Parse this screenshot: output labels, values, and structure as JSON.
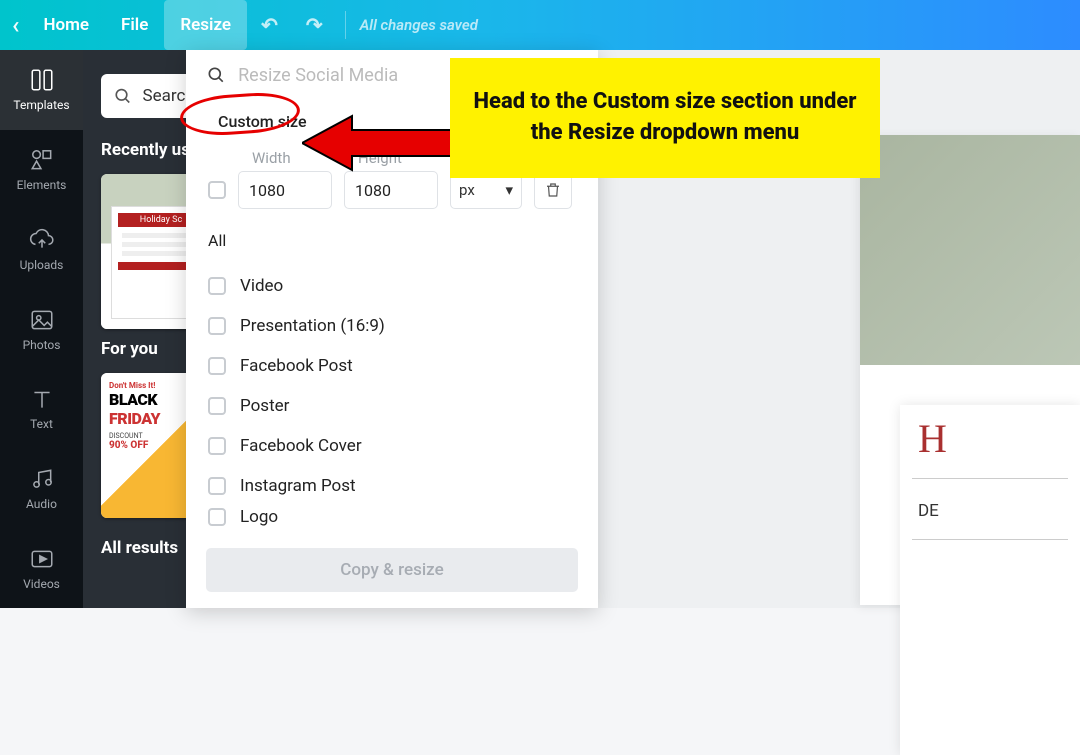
{
  "topbar": {
    "home": "Home",
    "file": "File",
    "resize": "Resize",
    "status": "All changes saved"
  },
  "sidebar": {
    "templates": "Templates",
    "elements": "Elements",
    "uploads": "Uploads",
    "photos": "Photos",
    "text": "Text",
    "audio": "Audio",
    "videos": "Videos"
  },
  "panel": {
    "search_placeholder": "Search",
    "search_value": "Searc",
    "recently_used": "Recently us",
    "for_you": "For you",
    "all_results": "All results"
  },
  "thumbs": {
    "holiday_title": "Holiday Sc",
    "bf_tag": "Don't Miss It!",
    "bf_black": "BLACK",
    "bf_friday": "FRIDAY",
    "bf_disc": "DISCOUNT",
    "bf_off": "90% OFF"
  },
  "dropdown": {
    "search_placeholder": "Resize Social Media",
    "custom_size": "Custom size",
    "width_label": "Width",
    "height_label": "Height",
    "width_value": "1080",
    "height_value": "1080",
    "unit": "px",
    "all": "All",
    "options": {
      "video": "Video",
      "presentation": "Presentation (16:9)",
      "fbpost": "Facebook Post",
      "poster": "Poster",
      "fbcover": "Facebook Cover",
      "igpost": "Instagram Post",
      "logo": "Logo"
    },
    "copy_resize": "Copy & resize"
  },
  "doc": {
    "h_fragment": "H",
    "d_fragment": "DE"
  },
  "annotation": {
    "text": "Head to the Custom size section under the Resize dropdown menu"
  }
}
